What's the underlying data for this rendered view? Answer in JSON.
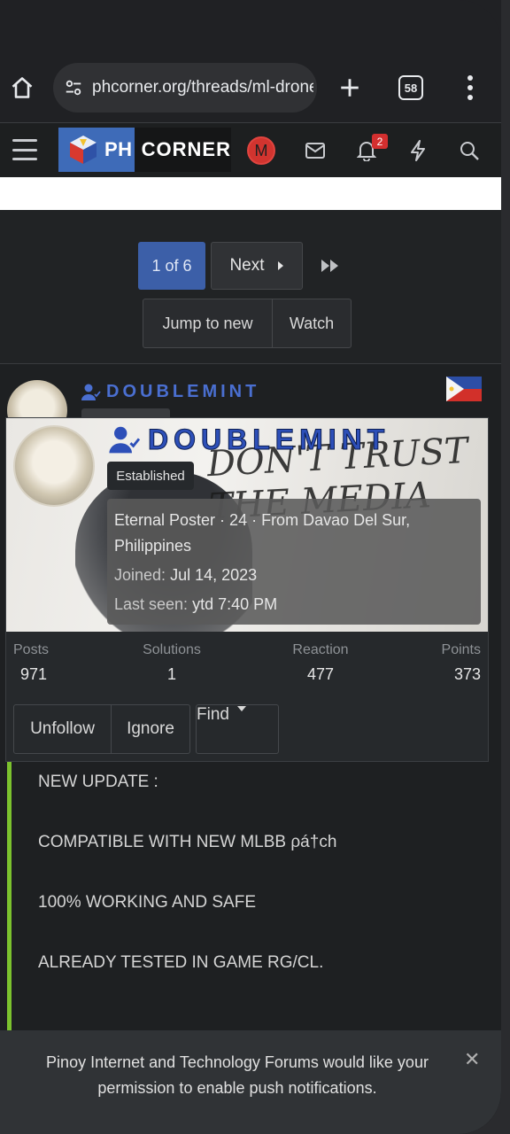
{
  "browser": {
    "url": "phcorner.org/threads/ml-drone-",
    "tab_count": "58"
  },
  "site": {
    "logo_ph": "PH",
    "logo_corner": "CORNER",
    "avatar_letter": "M",
    "notif_count": "2"
  },
  "pagination": {
    "current": "1 of 6",
    "next": "Next",
    "jump": "Jump to new",
    "watch": "Watch"
  },
  "post": {
    "username": "DOUBLEMINT"
  },
  "profile": {
    "username": "DOUBLEMINT",
    "badge": "Established",
    "info_line1": "Eternal Poster · 24 · From Davao Del Sur, Philippines",
    "joined_label": "Joined:",
    "joined_value": "Jul 14, 2023",
    "seen_label": "Last seen:",
    "seen_value": "ytd 7:40 PM",
    "banner_text": "DON'T TRUST THE MEDIA",
    "stats": [
      {
        "label": "Posts",
        "value": "971"
      },
      {
        "label": "Solutions",
        "value": "1"
      },
      {
        "label": "Reaction",
        "value": "477"
      },
      {
        "label": "Points",
        "value": "373"
      }
    ],
    "actions": {
      "unfollow": "Unfollow",
      "ignore": "Ignore",
      "find": "Find"
    }
  },
  "content": {
    "lines": [
      "NEW UPDATE :",
      "COMPATIBLE WITH NEW MLBB ρá†ch",
      "100% WORKING AND SAFE",
      "ALREADY TESTED IN GAME RG/CL."
    ]
  },
  "notification": {
    "message": "Pinoy Internet and Technology Forums would like your permission to enable push notifications.",
    "close": "✕"
  },
  "colors": {
    "accent_blue": "#3c5fa8",
    "username_blue": "#4a6fd1",
    "quote_green": "#7cc22e",
    "badge_red": "#d32f2f"
  }
}
